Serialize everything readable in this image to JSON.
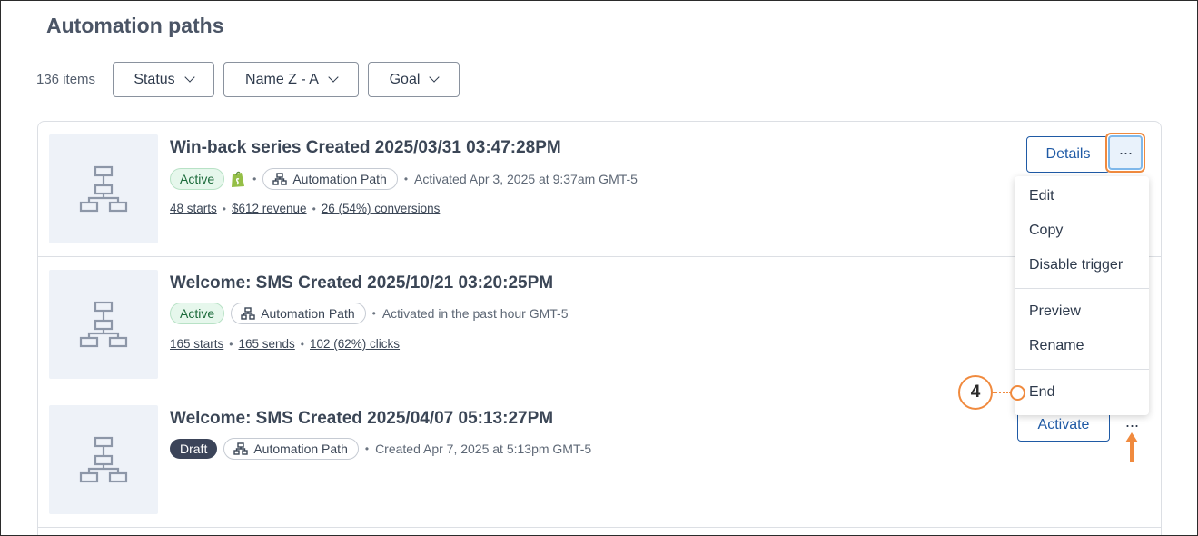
{
  "page": {
    "title": "Automation paths"
  },
  "toolbar": {
    "count": "136 items",
    "filters": [
      {
        "label": "Status"
      },
      {
        "label": "Name Z - A"
      },
      {
        "label": "Goal"
      }
    ]
  },
  "rows": [
    {
      "title": "Win-back series Created 2025/03/31 03:47:28PM",
      "status": "Active",
      "has_shopify": true,
      "type": "Automation Path",
      "activity": "Activated Apr 3, 2025 at 9:37am GMT-5",
      "stats": [
        "48 starts",
        "$612 revenue",
        "26 (54%) conversions"
      ],
      "primary_action": "Details"
    },
    {
      "title": "Welcome: SMS Created 2025/10/21 03:20:25PM",
      "status": "Active",
      "type": "Automation Path",
      "activity": "Activated in the past hour GMT-5",
      "stats": [
        "165 starts",
        "165 sends",
        "102 (62%) clicks"
      ]
    },
    {
      "title": "Welcome: SMS Created 2025/04/07 05:13:27PM",
      "status": "Draft",
      "type": "Automation Path",
      "activity": "Created Apr 7, 2025 at 5:13pm GMT-5",
      "primary_action": "Activate"
    }
  ],
  "menu": {
    "items": [
      "Edit",
      "Copy",
      "Disable trigger",
      "Preview",
      "Rename",
      "End"
    ]
  },
  "more_label": "···",
  "callout": {
    "number": "4"
  },
  "colors": {
    "accent_blue": "#1f5aa5",
    "highlight_orange": "#f08a3e",
    "active_green": "#1c6b3b",
    "draft_dark": "#3b4459",
    "thumb_bg": "#eef2f8"
  }
}
